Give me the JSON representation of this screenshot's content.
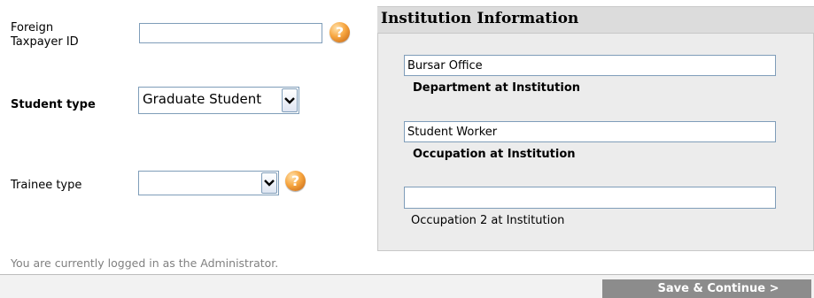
{
  "left_form": {
    "foreign_taxpayer_label": "Foreign Taxpayer ID",
    "foreign_taxpayer_value": "",
    "student_type_label": "Student type",
    "student_type_value": "Graduate Student",
    "trainee_type_label": "Trainee type",
    "trainee_type_value": "",
    "help_icon_glyph": "?"
  },
  "institution": {
    "title": "Institution Information",
    "department_value": "Bursar Office",
    "department_label": "Department at Institution",
    "occupation_value": "Student Worker",
    "occupation_label": "Occupation at Institution",
    "occupation2_value": "",
    "occupation2_label": "Occupation 2 at Institution"
  },
  "status": {
    "login_text": "You are currently logged in as the Administrator."
  },
  "footer": {
    "save_label": "Save & Continue >"
  },
  "icons": {
    "help": "question-help-icon",
    "dropdown": "chevron-down-icon"
  },
  "colors": {
    "panel_bg": "#ececec",
    "panel_header_bg": "#dcdcdc",
    "save_button_bg": "#8c8c8c",
    "help_icon": "#f7a640",
    "status_text": "#808080"
  }
}
